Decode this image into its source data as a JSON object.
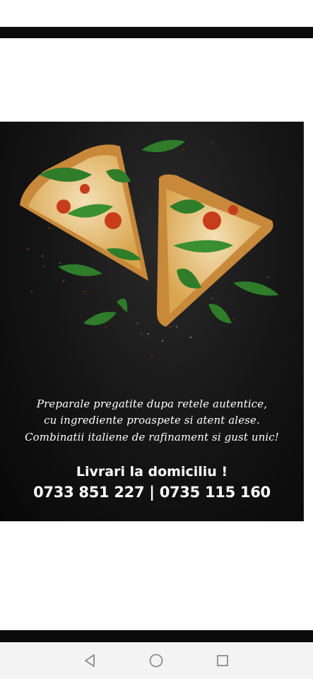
{
  "poster": {
    "tagline": [
      "Preparale pregatite dupa retele autentice,",
      "cu ingrediente proaspete si atent  alese.",
      "Combinatii italiene de rafinament  si gust  unic!"
    ],
    "delivery_label": "Livrari la domiciliu !",
    "phones": "0733 851 227 | 0735 115 160"
  },
  "navbar": {
    "icons": [
      "back-icon",
      "home-icon",
      "recent-apps-icon"
    ]
  },
  "colors": {
    "background": "#ffffff",
    "bars": "#0b0b0b",
    "poster": "#141414",
    "navbar": "#f3f3f3",
    "text": "#ffffff"
  }
}
